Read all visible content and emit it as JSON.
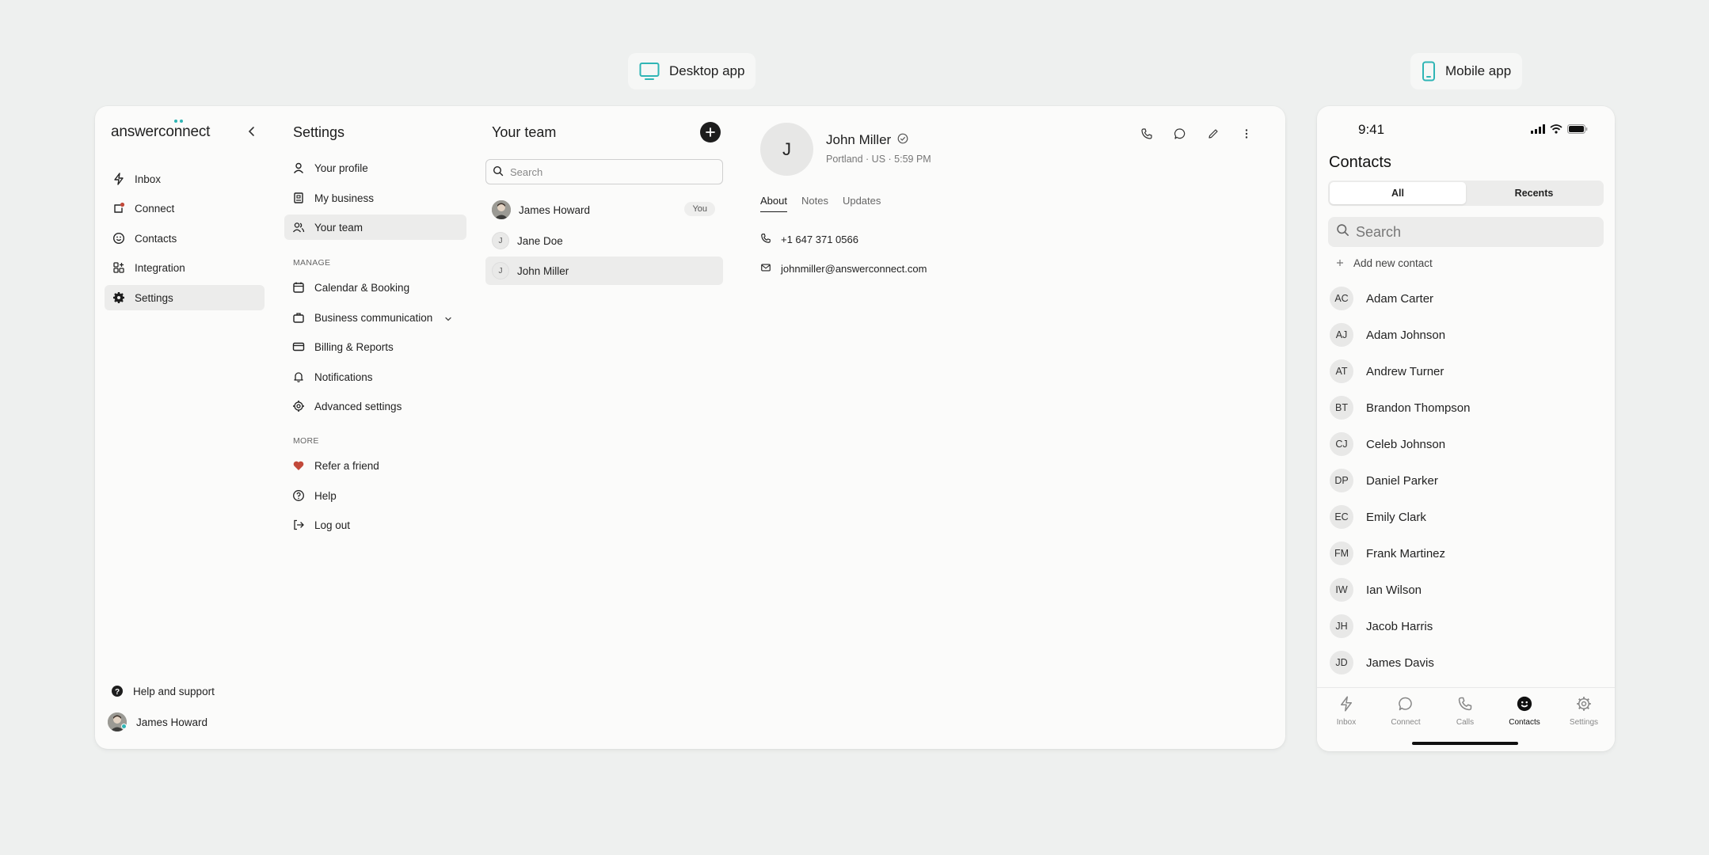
{
  "labels": {
    "desktop": "Desktop app",
    "mobile": "Mobile app"
  },
  "colors": {
    "accent": "#2fb5b5",
    "heart": "#c2493a",
    "dark": "#1d1d1d"
  },
  "sidebar": {
    "logo": "answerconnect",
    "items": [
      {
        "label": "Inbox",
        "icon": "bolt-icon"
      },
      {
        "label": "Connect",
        "icon": "connect-icon"
      },
      {
        "label": "Contacts",
        "icon": "smile-icon"
      },
      {
        "label": "Integration",
        "icon": "grid-icon"
      },
      {
        "label": "Settings",
        "icon": "gear-icon",
        "active": true
      }
    ],
    "footer": {
      "help": "Help and support",
      "user": "James Howard"
    }
  },
  "settings": {
    "title": "Settings",
    "top_items": [
      "Your profile",
      "My business",
      "Your team"
    ],
    "manage_label": "MANAGE",
    "manage_items": [
      "Calendar & Booking",
      "Business communication",
      "Billing & Reports",
      "Notifications",
      "Advanced settings"
    ],
    "more_label": "MORE",
    "more_items": [
      "Refer a friend",
      "Help",
      "Log out"
    ]
  },
  "team": {
    "title": "Your team",
    "search_placeholder": "Search",
    "members": [
      {
        "name": "James Howard",
        "initial": "",
        "badge": "You"
      },
      {
        "name": "Jane Doe",
        "initial": "J"
      },
      {
        "name": "John Miller",
        "initial": "J",
        "active": true
      }
    ]
  },
  "detail": {
    "initial": "J",
    "name": "John Miller",
    "location": "Portland · US · 5:59 PM",
    "tabs": [
      "About",
      "Notes",
      "Updates"
    ],
    "phone": "+1 647 371 0566",
    "email": "johnmiller@answerconnect.com"
  },
  "mobile": {
    "time": "9:41",
    "title": "Contacts",
    "segments": [
      "All",
      "Recents"
    ],
    "search_placeholder": "Search",
    "add_label": "Add new contact",
    "contacts": [
      {
        "initials": "AC",
        "name": "Adam Carter"
      },
      {
        "initials": "AJ",
        "name": "Adam Johnson"
      },
      {
        "initials": "AT",
        "name": "Andrew Turner"
      },
      {
        "initials": "BT",
        "name": "Brandon Thompson"
      },
      {
        "initials": "CJ",
        "name": "Celeb Johnson"
      },
      {
        "initials": "DP",
        "name": "Daniel Parker"
      },
      {
        "initials": "EC",
        "name": "Emily Clark"
      },
      {
        "initials": "FM",
        "name": "Frank Martinez"
      },
      {
        "initials": "IW",
        "name": "Ian Wilson"
      },
      {
        "initials": "JH",
        "name": "Jacob Harris"
      },
      {
        "initials": "JD",
        "name": "James Davis"
      }
    ],
    "tabbar": [
      "Inbox",
      "Connect",
      "Calls",
      "Contacts",
      "Settings"
    ]
  }
}
